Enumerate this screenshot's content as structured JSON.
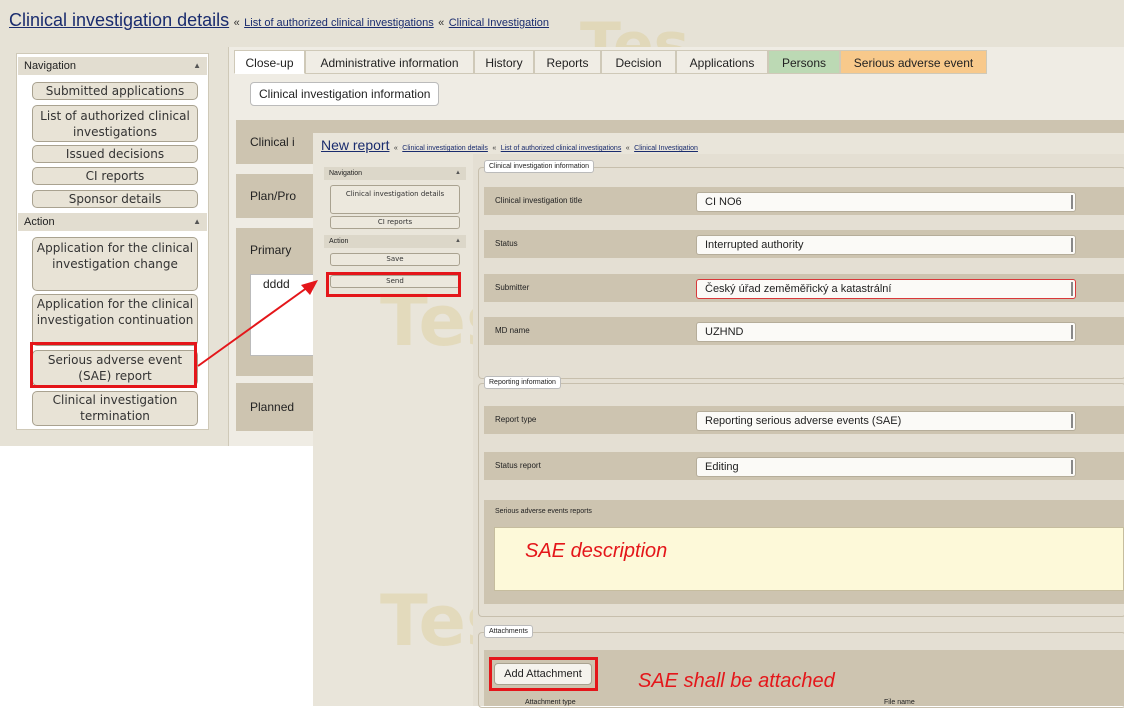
{
  "background": {
    "title": "Clinical investigation details",
    "breadcrumb": [
      {
        "sep": "«"
      },
      {
        "link": "List of authorized clinical investigations"
      },
      {
        "sep": "«"
      },
      {
        "link": "Clinical Investigation"
      }
    ],
    "sidebar": {
      "navigation_heading": "Navigation",
      "navigation_items": [
        "Submitted applications",
        "List of authorized clinical investigations",
        "Issued decisions",
        "CI reports",
        "Sponsor details"
      ],
      "action_heading": "Action",
      "action_items": [
        "Application for the clinical investigation change",
        "Application for the clinical investigation continuation",
        "Serious adverse event (SAE) report",
        "Clinical investigation termination"
      ]
    },
    "tabs": [
      "Close-up",
      "Administrative information",
      "History",
      "Reports",
      "Decision",
      "Applications",
      "Persons",
      "Serious adverse event"
    ],
    "fieldset_legend": "Clinical investigation information",
    "rows": [
      "Clinical i",
      "Plan/Pro",
      "Primary",
      "dddd",
      "Planned"
    ],
    "watermark": "Tes"
  },
  "foreground": {
    "title": "New report",
    "breadcrumb": [
      "Clinical investigation details",
      "List of authorized clinical investigations",
      "Clinical Investigation"
    ],
    "sidebar": {
      "navigation_heading": "Navigation",
      "navigation_items": [
        "Clinical investigation details",
        "CI reports"
      ],
      "action_heading": "Action",
      "action_items": [
        "Save",
        "Send"
      ]
    },
    "ci_info": {
      "legend": "Clinical investigation information",
      "fields": [
        {
          "label": "Clinical investigation title",
          "value": "CI NO6"
        },
        {
          "label": "Status",
          "value": "Interrupted authority"
        },
        {
          "label": "Submitter",
          "value": "Český úřad zeměměřický a katastrální"
        },
        {
          "label": "MD name",
          "value": "UZHND"
        }
      ]
    },
    "reporting": {
      "legend": "Reporting information",
      "fields": [
        {
          "label": "Report type",
          "value": "Reporting serious adverse events (SAE)"
        },
        {
          "label": "Status report",
          "value": "Editing"
        }
      ],
      "sae_label": "Serious adverse events reports",
      "sae_annotation": "SAE description"
    },
    "attachments": {
      "legend": "Attachments",
      "add_button": "Add Attachment",
      "annotation": "SAE shall be attached",
      "columns": [
        "Attachment type",
        "File name"
      ]
    }
  },
  "colors": {
    "highlight": "#e4161a",
    "link": "#1a2c6e",
    "tab_persons": "#bcd9b4",
    "tab_sae": "#f8c98b",
    "row_bg": "#cdc4b0",
    "sae_box": "#fdf9d9"
  }
}
